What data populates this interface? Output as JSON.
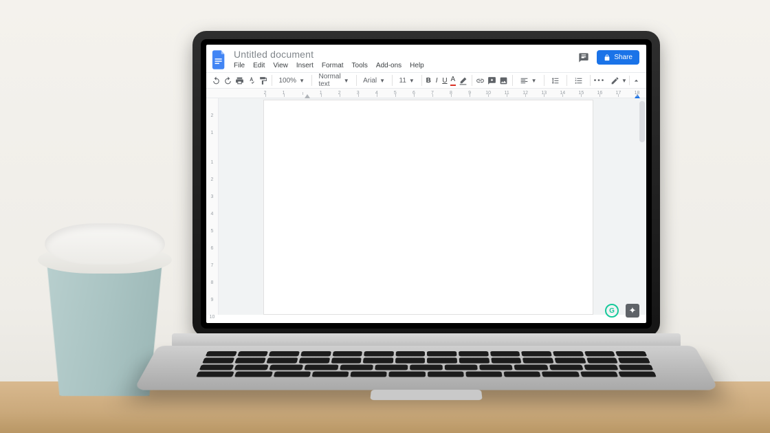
{
  "header": {
    "title": "Untitled document",
    "share_label": "Share",
    "menu": [
      "File",
      "Edit",
      "View",
      "Insert",
      "Format",
      "Tools",
      "Add-ons",
      "Help"
    ]
  },
  "toolbar": {
    "zoom": "100%",
    "style": "Normal text",
    "font": "Arial",
    "font_size": "11",
    "bold": "B",
    "italic": "I",
    "underline": "U",
    "text_color": "A"
  },
  "ruler": {
    "h_ticks": [
      "2",
      "1",
      "",
      "1",
      "2",
      "3",
      "4",
      "5",
      "6",
      "7",
      "8",
      "9",
      "10",
      "11",
      "12",
      "13",
      "14",
      "15",
      "16",
      "17",
      "18"
    ],
    "v_ticks": [
      "",
      "2",
      "1",
      "",
      "1",
      "2",
      "3",
      "4",
      "5",
      "6",
      "7",
      "8",
      "9",
      "10"
    ],
    "left_margin_tick": 2,
    "right_margin_tick": 18
  },
  "footer": {
    "grammarly_letter": "G",
    "explore_glyph": "✦"
  }
}
